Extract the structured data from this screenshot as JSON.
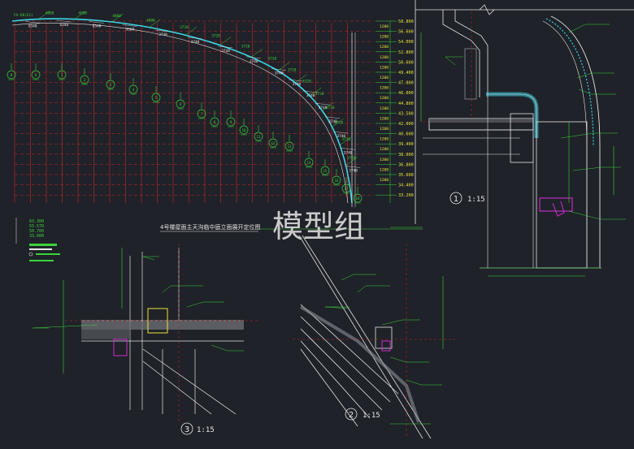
{
  "colors": {
    "background": "#1f2228",
    "red_lines": "#c8262b",
    "green": "#3cd23c",
    "cyan": "#3ad6e6",
    "white": "#e6e6e6",
    "yellow": "#e8e43a",
    "magenta": "#d02ad2",
    "grey": "#8a8f96",
    "watermark": "#d9d9d9"
  },
  "watermark": "模型组",
  "elevation_title": "4号楼屋面主天沟临中庭立面展开定位图",
  "details": {
    "d1_scale_num": "1",
    "d1_scale": "1:15",
    "d2_scale_num": "2",
    "d2_scale": "1:15",
    "d3_scale_num": "3",
    "d3_scale": "1:15"
  },
  "elevation": {
    "right_levels": [
      "58.800",
      "56.600",
      "54.000",
      "52.800",
      "50.600",
      "49.400",
      "47.800",
      "46.000",
      "44.800",
      "43.500",
      "42.000",
      "40.600",
      "39.400",
      "38.000",
      "36.800",
      "35.600",
      "34.400",
      "33.200"
    ],
    "right_dims": [
      "1200",
      "1200",
      "1200",
      "1200",
      "1200",
      "1200",
      "1200",
      "1200",
      "1200",
      "1200",
      "1200",
      "1200",
      "1200",
      "1200",
      "1200",
      "1200"
    ],
    "top_labels": [
      "FA-D8(E1)",
      "4800",
      "4800",
      "4800",
      "4800",
      "3720",
      "3720",
      "3720",
      "3720",
      "3720",
      "3720",
      "3720",
      "3720",
      "3720",
      "3720",
      "3720"
    ],
    "dims_along_arc": [
      "6340",
      "6340",
      "6340",
      "3560",
      "3740",
      "3740",
      "3740",
      "3740",
      "3740",
      "3740",
      "3740",
      "3740",
      "3740",
      "3740",
      "3740",
      "3740"
    ],
    "markers": [
      "B",
      "A",
      "1",
      "2",
      "3",
      "4",
      "5",
      "6",
      "7",
      "8",
      "9",
      "10",
      "11",
      "12",
      "13",
      "14",
      "15",
      "16",
      "17",
      "18"
    ]
  },
  "legend": {
    "title_level": "63.300",
    "rows": [
      "63.300",
      "55.570",
      "50.700",
      "33.000"
    ]
  }
}
